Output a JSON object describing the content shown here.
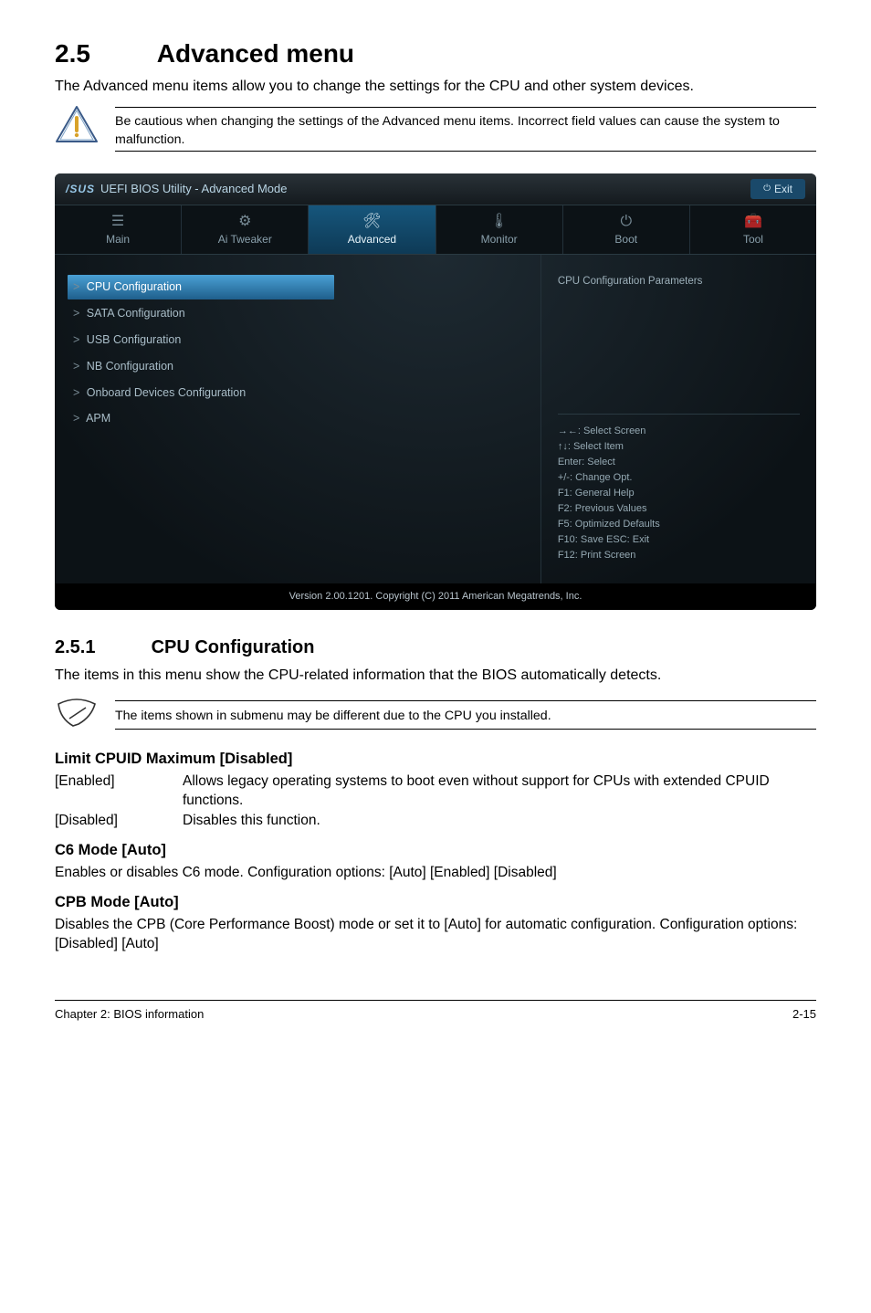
{
  "section": {
    "number": "2.5",
    "title": "Advanced menu"
  },
  "intro": "The Advanced menu items allow you to change the settings for the CPU and other system devices.",
  "caution": "Be cautious when changing the settings of the Advanced menu items. Incorrect field values can cause the system to malfunction.",
  "bios": {
    "brand": "/SUS",
    "titlebar": "UEFI BIOS Utility - Advanced Mode",
    "exit": "Exit",
    "tabs": [
      {
        "icon": "☰",
        "label": "Main"
      },
      {
        "icon": "⚙",
        "label": "Ai Tweaker"
      },
      {
        "icon": "🛠",
        "label": "Advanced"
      },
      {
        "icon": "🌡",
        "label": "Monitor"
      },
      {
        "icon": "⏻",
        "label": "Boot"
      },
      {
        "icon": "🧰",
        "label": "Tool"
      }
    ],
    "active_tab_index": 2,
    "menu": [
      "CPU Configuration",
      "SATA Configuration",
      "USB Configuration",
      "NB Configuration",
      "Onboard Devices Configuration",
      "APM"
    ],
    "selected_menu_index": 0,
    "right_heading": "CPU Configuration Parameters",
    "help_keys": [
      "→←: Select Screen",
      "↑↓: Select Item",
      "Enter: Select",
      "+/-: Change Opt.",
      "F1: General Help",
      "F2: Previous Values",
      "F5: Optimized Defaults",
      "F10: Save   ESC: Exit",
      "F12: Print Screen"
    ],
    "footer": "Version 2.00.1201.  Copyright (C) 2011 American Megatrends, Inc."
  },
  "subsection": {
    "number": "2.5.1",
    "title": "CPU Configuration"
  },
  "subsection_intro": "The items in this menu show the CPU-related information that the BIOS automatically detects.",
  "note": "The items shown in submenu may be different due to the CPU you installed.",
  "options": {
    "limit_cpuid": {
      "heading": "Limit CPUID Maximum [Disabled]",
      "rows": [
        {
          "k": "[Enabled]",
          "v": "Allows legacy operating systems to boot even without support for CPUs with extended CPUID functions."
        },
        {
          "k": "[Disabled]",
          "v": "Disables this function."
        }
      ]
    },
    "c6": {
      "heading": "C6 Mode [Auto]",
      "desc": "Enables or disables C6 mode. Configuration options: [Auto] [Enabled] [Disabled]"
    },
    "cpb": {
      "heading": "CPB Mode [Auto]",
      "desc": "Disables the CPB (Core Performance Boost) mode or set it to [Auto] for automatic configuration. Configuration options: [Disabled] [Auto]"
    }
  },
  "footer": {
    "left": "Chapter 2: BIOS information",
    "right": "2-15"
  }
}
